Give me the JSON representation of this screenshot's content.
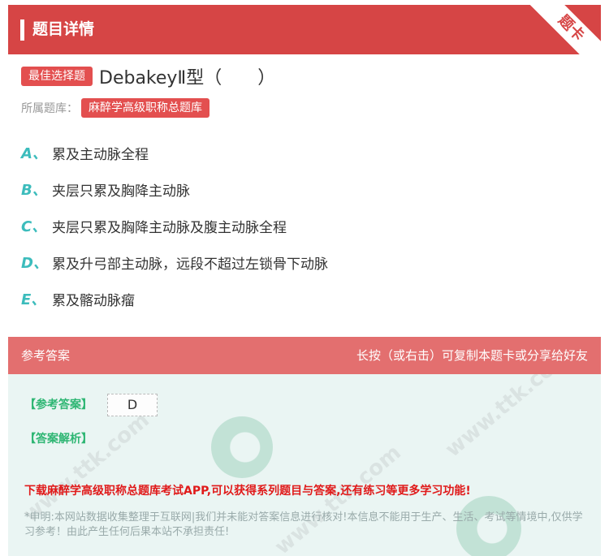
{
  "header": {
    "title": "题目详情",
    "ribbon": "题卡"
  },
  "question": {
    "type_tag": "最佳选择题",
    "text": "DebakeyⅡ型（　　）",
    "source_label": "所属题库：",
    "source_value": "麻醉学高级职称总题库"
  },
  "options": [
    {
      "letter": "A、",
      "text": "累及主动脉全程"
    },
    {
      "letter": "B、",
      "text": "夹层只累及胸降主动脉"
    },
    {
      "letter": "C、",
      "text": "夹层只累及胸降主动脉及腹主动脉全程"
    },
    {
      "letter": "D、",
      "text": "累及升弓部主动脉，远段不超过左锁骨下动脉"
    },
    {
      "letter": "E、",
      "text": "累及髂动脉瘤"
    }
  ],
  "answer_section": {
    "header_left": "参考答案",
    "header_right": "长按（或右击）可复制本题卡或分享给好友",
    "answer_label": "【参考答案】",
    "answer_value": "D",
    "analysis_label": "【答案解析】",
    "promo": "下载麻醉学高级职称总题库考试APP,可以获得系列题目与答案,还有练习等更多学习功能!",
    "disclaimer": "*申明:本网站数据收集整理于互联网|我们并未能对答案信息进行核对!本信息不能用于生产、生活、考试等情境中,仅供学习参考！由此产生任何后果本站不承担责任!"
  },
  "colors": {
    "primary": "#d64545",
    "tag": "#e34f4f",
    "option_letter": "#3cbcbc",
    "answer_label": "#2eb673",
    "promo": "#e01a1a"
  }
}
